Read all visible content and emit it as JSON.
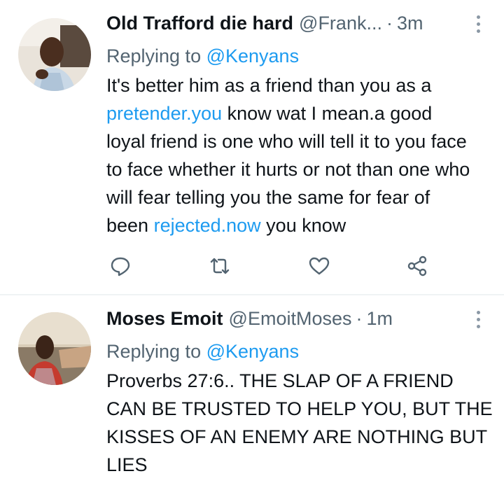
{
  "tweets": [
    {
      "name": "Old Trafford die hard",
      "handle": "@Frank...",
      "separator": "·",
      "time": "3m",
      "replying_prefix": "Replying to ",
      "replying_to": "@Kenyans",
      "body": [
        {
          "text": "It's better him as a friend than you as a "
        },
        {
          "text": "pretender.you",
          "link": true
        },
        {
          "text": " know wat I mean.a good loyal friend is one who will tell it to you face to face whether it hurts or not than one who will fear telling you the same for fear of been "
        },
        {
          "text": "rejected.now",
          "link": true
        },
        {
          "text": " you know"
        }
      ],
      "icons": [
        "reply-icon",
        "retweet-icon",
        "like-icon",
        "share-icon"
      ]
    },
    {
      "name": "Moses Emoit",
      "handle": "@EmoitMoses",
      "separator": "·",
      "time": "1m",
      "replying_prefix": "Replying to ",
      "replying_to": "@Kenyans",
      "body_text": "Proverbs 27:6.. THE SLAP OF A FRIEND CAN BE TRUSTED TO HELP YOU, BUT THE KISSES OF AN ENEMY ARE NOTHING BUT LIES"
    }
  ],
  "colors": {
    "link": "#1d9bf0",
    "secondary": "#536471",
    "primary": "#0f1419",
    "divider": "#eff3f4"
  }
}
